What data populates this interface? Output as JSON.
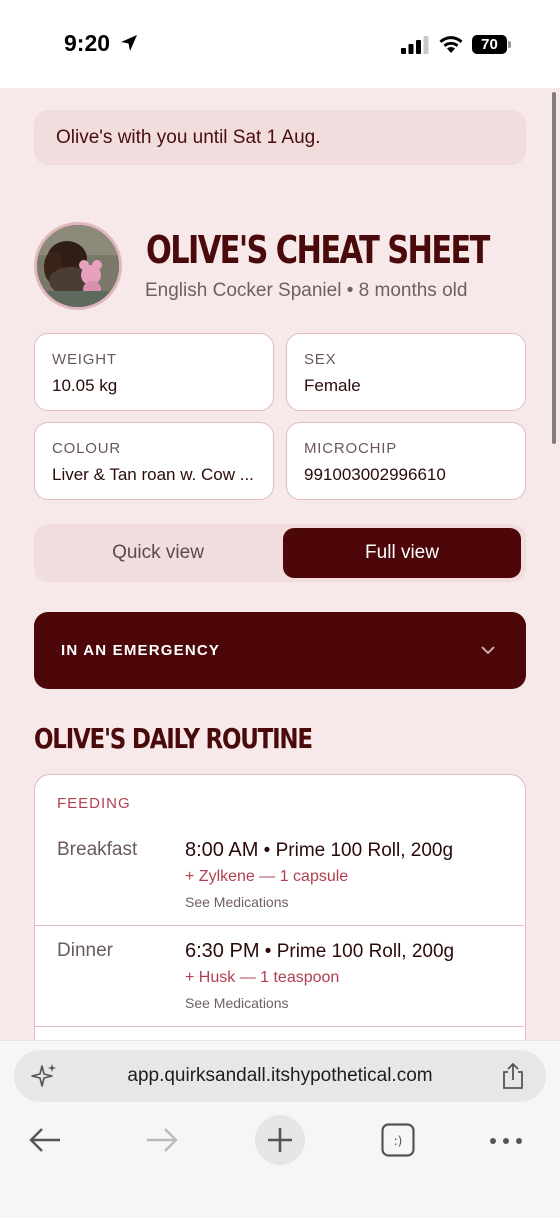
{
  "status_bar": {
    "time": "9:20",
    "battery": "70"
  },
  "banner": {
    "text": "Olive's with you until Sat 1 Aug."
  },
  "profile": {
    "title": "OLIVE'S CHEAT SHEET",
    "subtitle": "English Cocker Spaniel • 8 months old"
  },
  "info_cards": [
    {
      "label": "WEIGHT",
      "value": "10.05 kg"
    },
    {
      "label": "SEX",
      "value": "Female"
    },
    {
      "label": "COLOUR",
      "value": "Liver & Tan roan w. Cow ..."
    },
    {
      "label": "MICROCHIP",
      "value": "991003002996610"
    }
  ],
  "view_toggle": {
    "quick": "Quick view",
    "full": "Full view",
    "selected": "Full view"
  },
  "emergency": {
    "label": "IN AN EMERGENCY"
  },
  "routine": {
    "title": "OLIVE'S DAILY ROUTINE",
    "feeding_label": "FEEDING",
    "meals": [
      {
        "name": "Breakfast",
        "time": "8:00 AM",
        "food": " • Prime 100 Roll, 200g",
        "extra": "+ Zylkene — 1 capsule",
        "meds_link": "See Medications"
      },
      {
        "name": "Dinner",
        "time": "6:30 PM",
        "food": " • Prime 100 Roll, 200g",
        "extra": "+ Husk — 1 teaspoon",
        "meds_link": "See Medications"
      }
    ]
  },
  "browser": {
    "url": "app.quirksandall.itshypothetical.com"
  },
  "icons": {
    "location": "location-arrow-icon",
    "signal": "cellular-signal-icon",
    "wifi": "wifi-icon",
    "battery": "battery-icon",
    "chevron": "chevron-down-icon",
    "sparkle": "sparkle-icon",
    "share": "share-icon",
    "back": "back-arrow-icon",
    "forward": "forward-arrow-icon",
    "new_tab": "plus-icon",
    "tabs": "tabs-icon",
    "more": "more-icon"
  },
  "colors": {
    "page_bg": "#f7e8e9",
    "accent_dark": "#4d0709",
    "card_border": "#e2bcc1",
    "accent_red": "#b04050"
  }
}
